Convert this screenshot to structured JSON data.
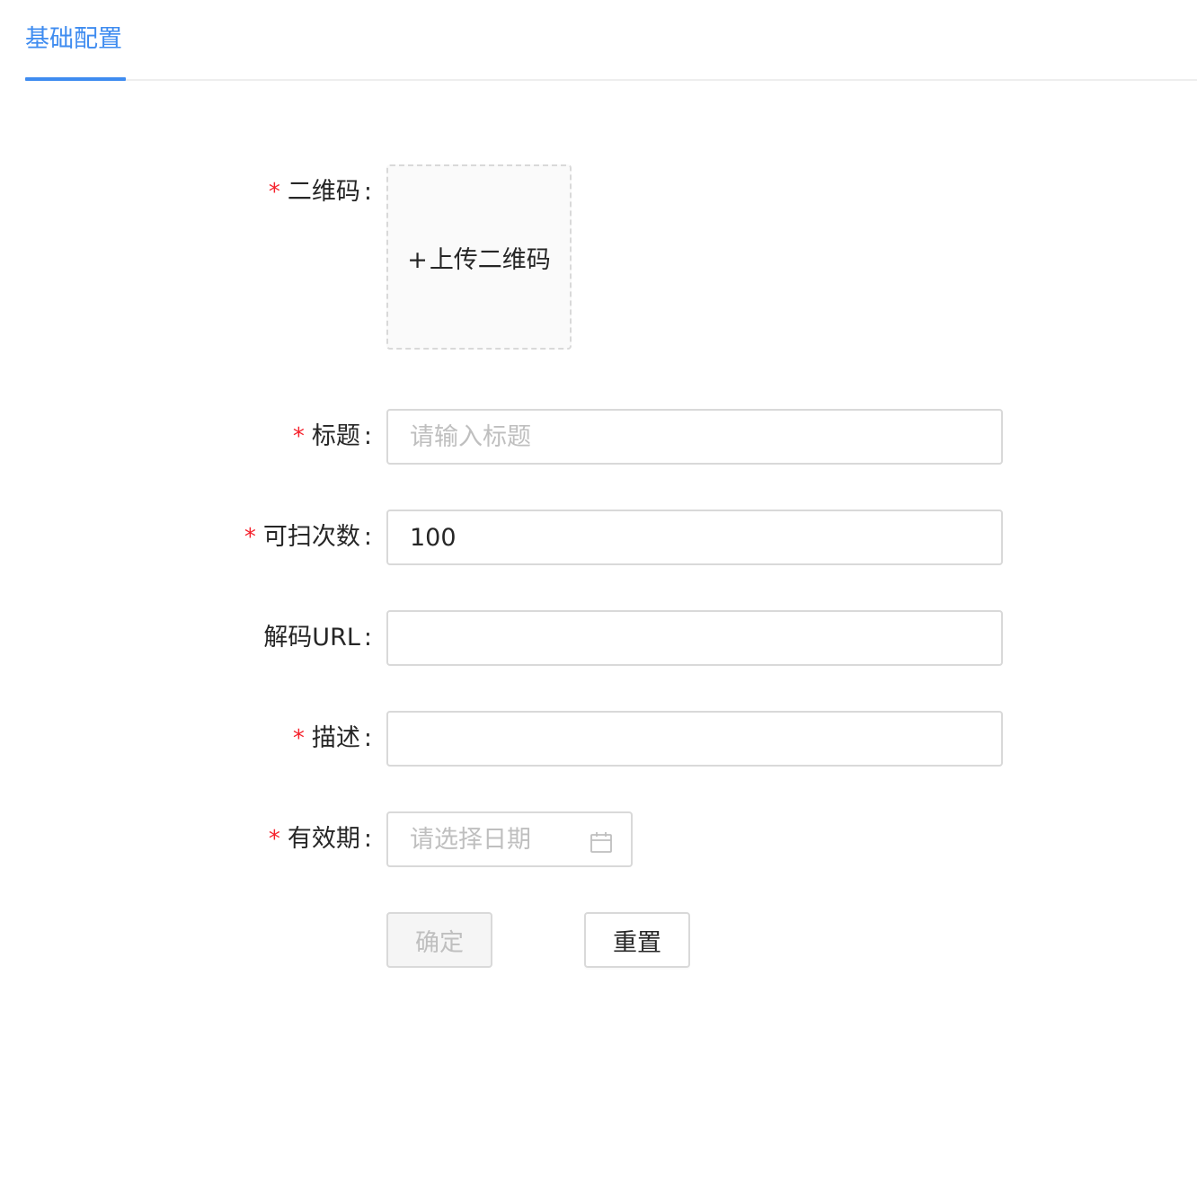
{
  "tabs": [
    {
      "label": "基础配置",
      "active": true
    }
  ],
  "form": {
    "qrcode": {
      "label": "二维码",
      "required": true,
      "upload_plus": "+",
      "upload_text": "上传二维码"
    },
    "title": {
      "label": "标题",
      "required": true,
      "placeholder": "请输入标题",
      "value": ""
    },
    "scan_count": {
      "label": "可扫次数",
      "required": true,
      "value": "100"
    },
    "decode_url": {
      "label": "解码URL",
      "required": false,
      "value": ""
    },
    "description": {
      "label": "描述",
      "required": true,
      "value": ""
    },
    "validity": {
      "label": "有效期",
      "required": true,
      "placeholder": "请选择日期",
      "icon": "calendar-icon"
    },
    "required_mark": "*",
    "colon": ":"
  },
  "buttons": {
    "confirm_label": "确定",
    "confirm_disabled": true,
    "reset_label": "重置"
  },
  "colors": {
    "accent": "#3f8cf0",
    "required": "#f5222d",
    "border": "#d9d9d9",
    "placeholder": "#bfbfbf"
  }
}
